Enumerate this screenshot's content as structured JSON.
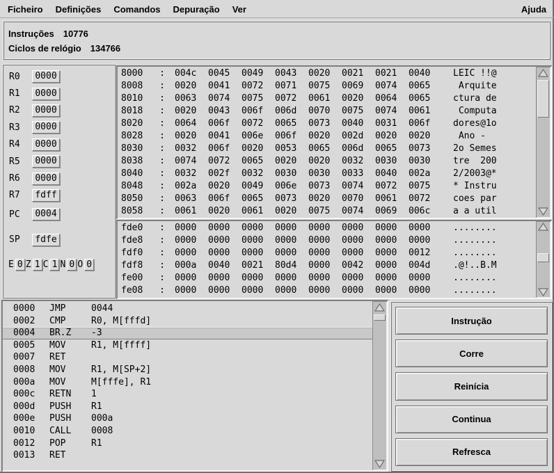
{
  "colors": {
    "background": "#d9d9d9",
    "selection": "#c9c9c9",
    "trough": "#bfbfbf"
  },
  "menu": {
    "items": [
      "Ficheiro",
      "Definições",
      "Comandos",
      "Depuração",
      "Ver"
    ],
    "help": "Ajuda"
  },
  "status": {
    "rows": [
      {
        "label": "Instruções",
        "value": "10776"
      },
      {
        "label": "Ciclos de relógio",
        "value": "134766"
      }
    ]
  },
  "registers": {
    "main": [
      {
        "name": "R0",
        "value": "0000"
      },
      {
        "name": "R1",
        "value": "0000"
      },
      {
        "name": "R2",
        "value": "0000"
      },
      {
        "name": "R3",
        "value": "0000"
      },
      {
        "name": "R4",
        "value": "0000"
      },
      {
        "name": "R5",
        "value": "0000"
      },
      {
        "name": "R6",
        "value": "0000"
      },
      {
        "name": "R7",
        "value": "fdff"
      }
    ],
    "pc": {
      "name": "PC",
      "value": "0004"
    },
    "sp": {
      "name": "SP",
      "value": "fdfe"
    },
    "flags": [
      {
        "name": "E",
        "value": "0"
      },
      {
        "name": "Z",
        "value": "1"
      },
      {
        "name": "C",
        "value": "1"
      },
      {
        "name": "N",
        "value": "0"
      },
      {
        "name": "O",
        "value": "0"
      }
    ]
  },
  "memory_top": {
    "separator": ":",
    "rows": [
      {
        "addr": "8000",
        "words": [
          "004c",
          "0045",
          "0049",
          "0043",
          "0020",
          "0021",
          "0021",
          "0040"
        ],
        "ascii": "LEIC !!@"
      },
      {
        "addr": "8008",
        "words": [
          "0020",
          "0041",
          "0072",
          "0071",
          "0075",
          "0069",
          "0074",
          "0065"
        ],
        "ascii": " Arquite"
      },
      {
        "addr": "8010",
        "words": [
          "0063",
          "0074",
          "0075",
          "0072",
          "0061",
          "0020",
          "0064",
          "0065"
        ],
        "ascii": "ctura de"
      },
      {
        "addr": "8018",
        "words": [
          "0020",
          "0043",
          "006f",
          "006d",
          "0070",
          "0075",
          "0074",
          "0061"
        ],
        "ascii": " Computa"
      },
      {
        "addr": "8020",
        "words": [
          "0064",
          "006f",
          "0072",
          "0065",
          "0073",
          "0040",
          "0031",
          "006f"
        ],
        "ascii": "dores@1o"
      },
      {
        "addr": "8028",
        "words": [
          "0020",
          "0041",
          "006e",
          "006f",
          "0020",
          "002d",
          "0020",
          "0020"
        ],
        "ascii": " Ano -"
      },
      {
        "addr": "8030",
        "words": [
          "0032",
          "006f",
          "0020",
          "0053",
          "0065",
          "006d",
          "0065",
          "0073"
        ],
        "ascii": "2o Semes"
      },
      {
        "addr": "8038",
        "words": [
          "0074",
          "0072",
          "0065",
          "0020",
          "0020",
          "0032",
          "0030",
          "0030"
        ],
        "ascii": "tre  200"
      },
      {
        "addr": "8040",
        "words": [
          "0032",
          "002f",
          "0032",
          "0030",
          "0030",
          "0033",
          "0040",
          "002a"
        ],
        "ascii": "2/2003@*"
      },
      {
        "addr": "8048",
        "words": [
          "002a",
          "0020",
          "0049",
          "006e",
          "0073",
          "0074",
          "0072",
          "0075"
        ],
        "ascii": "* Instru"
      },
      {
        "addr": "8050",
        "words": [
          "0063",
          "006f",
          "0065",
          "0073",
          "0020",
          "0070",
          "0061",
          "0072"
        ],
        "ascii": "coes par"
      },
      {
        "addr": "8058",
        "words": [
          "0061",
          "0020",
          "0061",
          "0020",
          "0075",
          "0074",
          "0069",
          "006c"
        ],
        "ascii": "a a util"
      }
    ]
  },
  "memory_stack": {
    "separator": ":",
    "rows": [
      {
        "addr": "fde0",
        "words": [
          "0000",
          "0000",
          "0000",
          "0000",
          "0000",
          "0000",
          "0000",
          "0000"
        ],
        "ascii": "........"
      },
      {
        "addr": "fde8",
        "words": [
          "0000",
          "0000",
          "0000",
          "0000",
          "0000",
          "0000",
          "0000",
          "0000"
        ],
        "ascii": "........"
      },
      {
        "addr": "fdf0",
        "words": [
          "0000",
          "0000",
          "0000",
          "0000",
          "0000",
          "0000",
          "0000",
          "0012"
        ],
        "ascii": "........"
      },
      {
        "addr": "fdf8",
        "words": [
          "000a",
          "0040",
          "0021",
          "80d4",
          "0000",
          "0042",
          "0000",
          "004d"
        ],
        "ascii": ".@!..B.M"
      },
      {
        "addr": "fe00",
        "words": [
          "0000",
          "0000",
          "0000",
          "0000",
          "0000",
          "0000",
          "0000",
          "0000"
        ],
        "ascii": "........"
      },
      {
        "addr": "fe08",
        "words": [
          "0000",
          "0000",
          "0000",
          "0000",
          "0000",
          "0000",
          "0000",
          "0000"
        ],
        "ascii": "........"
      }
    ]
  },
  "disassembly": {
    "rows": [
      {
        "addr": "0000",
        "op": "JMP",
        "args": "0044",
        "selected": false
      },
      {
        "addr": "0002",
        "op": "CMP",
        "args": "R0, M[fffd]",
        "selected": false
      },
      {
        "addr": "0004",
        "op": "BR.Z",
        "args": "-3",
        "selected": true
      },
      {
        "addr": "0005",
        "op": "MOV",
        "args": "R1, M[ffff]",
        "selected": false
      },
      {
        "addr": "0007",
        "op": "RET",
        "args": "",
        "selected": false
      },
      {
        "addr": "0008",
        "op": "MOV",
        "args": "R1, M[SP+2]",
        "selected": false
      },
      {
        "addr": "000a",
        "op": "MOV",
        "args": "M[fffe], R1",
        "selected": false
      },
      {
        "addr": "000c",
        "op": "RETN",
        "args": "1",
        "selected": false
      },
      {
        "addr": "000d",
        "op": "PUSH",
        "args": "R1",
        "selected": false
      },
      {
        "addr": "000e",
        "op": "PUSH",
        "args": "000a",
        "selected": false
      },
      {
        "addr": "0010",
        "op": "CALL",
        "args": "0008",
        "selected": false
      },
      {
        "addr": "0012",
        "op": "POP",
        "args": "R1",
        "selected": false
      },
      {
        "addr": "0013",
        "op": "RET",
        "args": "",
        "selected": false
      }
    ]
  },
  "buttons": [
    "Instrução",
    "Corre",
    "Reinícia",
    "Continua",
    "Refresca"
  ]
}
